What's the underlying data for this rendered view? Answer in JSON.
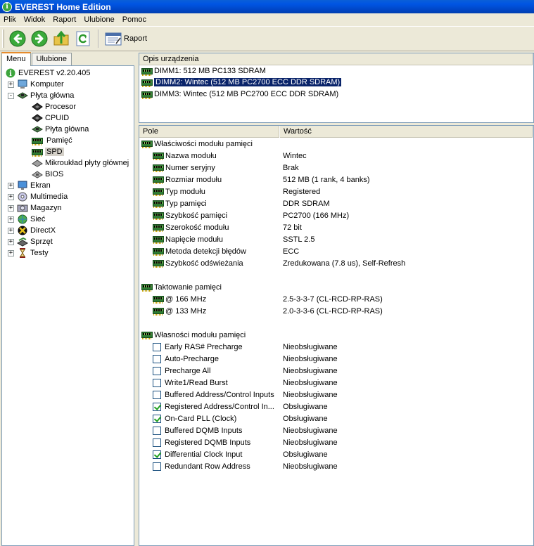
{
  "window": {
    "title": "EVEREST Home Edition"
  },
  "menu": [
    "Plik",
    "Widok",
    "Raport",
    "Ulubione",
    "Pomoc"
  ],
  "toolbar": {
    "report_label": "Raport"
  },
  "tabs": [
    "Menu",
    "Ulubione"
  ],
  "tree": {
    "root": "EVEREST v2.20.405",
    "items": [
      {
        "label": "Komputer",
        "icon": "computer-icon",
        "expander": "+"
      },
      {
        "label": "Płyta główna",
        "icon": "motherboard-icon",
        "expander": "-"
      },
      {
        "label": "Procesor",
        "icon": "cpu-icon"
      },
      {
        "label": "CPUID",
        "icon": "cpu-icon"
      },
      {
        "label": "Płyta główna",
        "icon": "motherboard-icon"
      },
      {
        "label": "Pamięć",
        "icon": "memory-icon"
      },
      {
        "label": "SPD",
        "icon": "memory-icon"
      },
      {
        "label": "Mikroukład płyty głównej",
        "icon": "chipset-icon"
      },
      {
        "label": "BIOS",
        "icon": "bios-icon"
      },
      {
        "label": "Ekran",
        "icon": "display-icon",
        "expander": "+"
      },
      {
        "label": "Multimedia",
        "icon": "multimedia-icon",
        "expander": "+"
      },
      {
        "label": "Magazyn",
        "icon": "storage-icon",
        "expander": "+"
      },
      {
        "label": "Sieć",
        "icon": "network-icon",
        "expander": "+"
      },
      {
        "label": "DirectX",
        "icon": "directx-icon",
        "expander": "+"
      },
      {
        "label": "Sprzęt",
        "icon": "devices-icon",
        "expander": "+"
      },
      {
        "label": "Testy",
        "icon": "hourglass-icon",
        "expander": "+"
      }
    ]
  },
  "devices": {
    "header": "Opis urządzenia",
    "items": [
      "DIMM1: 512 MB PC133 SDRAM",
      "DIMM2: Wintec (512 MB PC2700 ECC DDR SDRAM)",
      "DIMM3: Wintec (512 MB PC2700 ECC DDR SDRAM)"
    ]
  },
  "details": {
    "col_field": "Pole",
    "col_value": "Wartość",
    "groups": [
      {
        "title": "Właściwości modułu pamięci",
        "rows": [
          {
            "field": "Nazwa modułu",
            "value": "Wintec"
          },
          {
            "field": "Numer seryjny",
            "value": "Brak"
          },
          {
            "field": "Rozmiar modułu",
            "value": "512 MB (1 rank, 4 banks)"
          },
          {
            "field": "Typ modułu",
            "value": "Registered"
          },
          {
            "field": "Typ pamięci",
            "value": "DDR SDRAM"
          },
          {
            "field": "Szybkość pamięci",
            "value": "PC2700 (166 MHz)"
          },
          {
            "field": "Szerokość modułu",
            "value": "72 bit"
          },
          {
            "field": "Napięcie modułu",
            "value": "SSTL 2.5"
          },
          {
            "field": "Metoda detekcji błędów",
            "value": "ECC"
          },
          {
            "field": "Szybkość odświeżania",
            "value": "Zredukowana (7.8 us), Self-Refresh"
          }
        ]
      },
      {
        "title": "Taktowanie pamięci",
        "rows": [
          {
            "field": "@ 166 MHz",
            "value": "2.5-3-3-7  (CL-RCD-RP-RAS)"
          },
          {
            "field": "@ 133 MHz",
            "value": "2.0-3-3-6  (CL-RCD-RP-RAS)"
          }
        ]
      },
      {
        "title": "Własności modułu pamięci",
        "checks": [
          {
            "field": "Early RAS# Precharge",
            "value": "Nieobsługiwane",
            "checked": false
          },
          {
            "field": "Auto-Precharge",
            "value": "Nieobsługiwane",
            "checked": false
          },
          {
            "field": "Precharge All",
            "value": "Nieobsługiwane",
            "checked": false
          },
          {
            "field": "Write1/Read Burst",
            "value": "Nieobsługiwane",
            "checked": false
          },
          {
            "field": "Buffered Address/Control Inputs",
            "value": "Nieobsługiwane",
            "checked": false
          },
          {
            "field": "Registered Address/Control In...",
            "value": "Obsługiwane",
            "checked": true
          },
          {
            "field": "On-Card PLL (Clock)",
            "value": "Obsługiwane",
            "checked": true
          },
          {
            "field": "Buffered DQMB Inputs",
            "value": "Nieobsługiwane",
            "checked": false
          },
          {
            "field": "Registered DQMB Inputs",
            "value": "Nieobsługiwane",
            "checked": false
          },
          {
            "field": "Differential Clock Input",
            "value": "Obsługiwane",
            "checked": true
          },
          {
            "field": "Redundant Row Address",
            "value": "Nieobsługiwane",
            "checked": false
          }
        ]
      }
    ]
  }
}
